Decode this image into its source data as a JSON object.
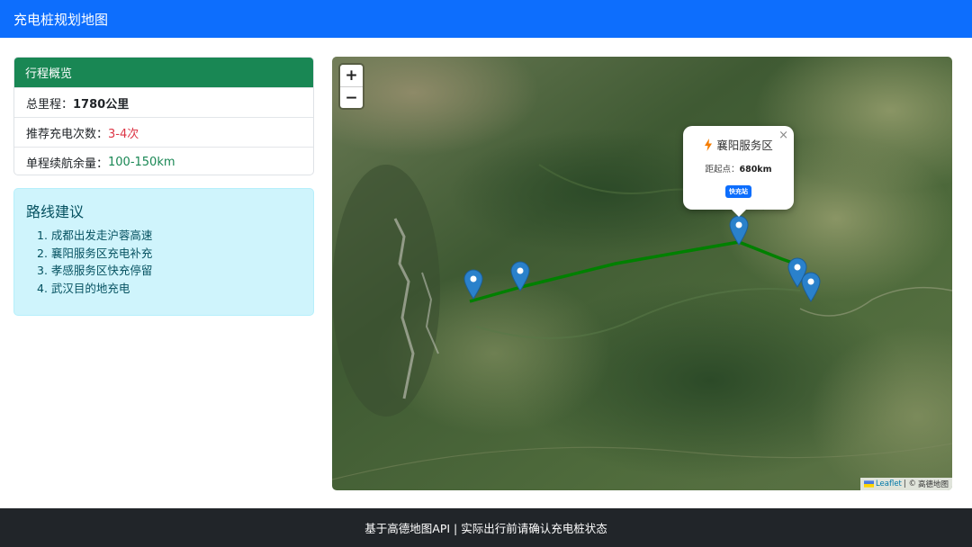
{
  "navbar": {
    "title": "充电桩规划地图"
  },
  "overview": {
    "title": "行程概览",
    "rows": [
      {
        "label": "总里程：",
        "value": "1780公里"
      },
      {
        "label": "推荐充电次数：",
        "value": "3-4次"
      },
      {
        "label": "单程续航余量：",
        "value": "100-150km"
      }
    ]
  },
  "route": {
    "title": "路线建议",
    "items": [
      "1. 成都出发走沪蓉高速",
      "2. 襄阳服务区充电补充",
      "3. 孝感服务区快充停留",
      "4. 武汉目的地充电"
    ]
  },
  "map": {
    "zoom_in": "+",
    "zoom_out": "−",
    "popup": {
      "title": "襄阳服务区",
      "distance_label": "距起点：",
      "distance_value": "680km",
      "badge": "快充站",
      "close": "×",
      "icon": "lightning-icon"
    },
    "attribution": {
      "leaflet": "Leaflet",
      "separator": " | © ",
      "provider": "高德地图"
    },
    "route_color": "#008000",
    "marker_color": "#2a81cb"
  },
  "footer": {
    "text": "基于高德地图API | 实际出行前请确认充电桩状态"
  },
  "colors": {
    "primary": "#0d6efd",
    "success": "#198754",
    "danger": "#dc3545",
    "info_bg": "#cff4fc",
    "dark": "#212529"
  }
}
